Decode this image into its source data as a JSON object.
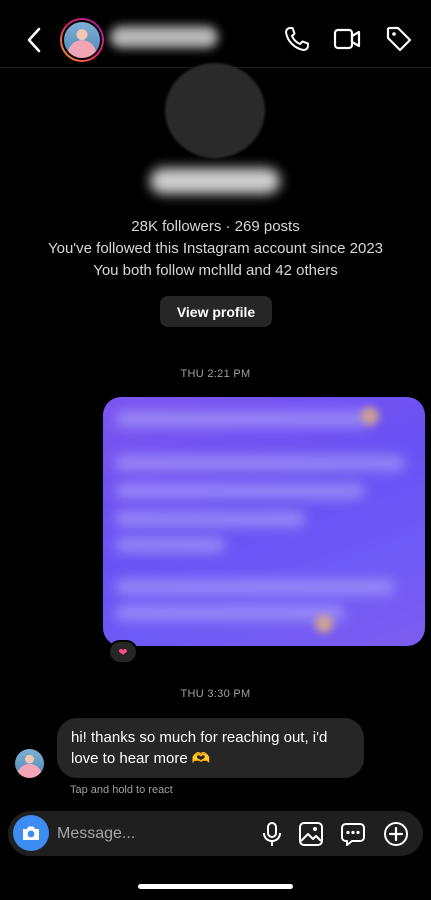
{
  "profile": {
    "followers_posts": "28K followers · 269 posts",
    "followed_since": "You've followed this Instagram account since 2023",
    "mutuals": "You both follow mchlld and 42 others",
    "view_profile_label": "View profile"
  },
  "messages": {
    "time1": "THU 2:21 PM",
    "time2": "THU 3:30 PM",
    "incoming_text": "hi! thanks so much for reaching out, i'd love to hear more 🫶",
    "tap_hint": "Tap and hold to react",
    "reaction_icon": "heart-icon"
  },
  "composer": {
    "placeholder": "Message..."
  },
  "colors": {
    "outgoing_bubble": "#6a52f4",
    "incoming_bubble": "#262626",
    "camera_button": "#3d8cf2"
  }
}
